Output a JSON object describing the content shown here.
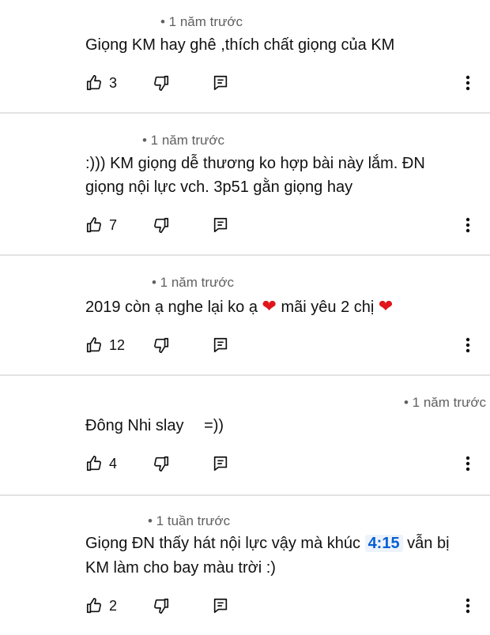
{
  "comments": [
    {
      "time": "• 1 năm trước",
      "lines": [
        "Giọng KM hay ghê ,thích chất giọng của KM"
      ],
      "likes": "3"
    },
    {
      "time": "• 1 năm trước",
      "lines": [
        ":))) KM giọng dễ thương ko hợp bài này lắm. ĐN",
        "giọng nội lực vch. 3p51 gằn giọng hay"
      ],
      "likes": "7"
    },
    {
      "time": "• 1 năm trước",
      "line_part1": "2019 còn ạ nghe lại ko ạ",
      "line_part2": "mãi yêu 2 chị",
      "heart": "❤",
      "likes": "12"
    },
    {
      "time": "• 1 năm trước",
      "line_part1": "Đông Nhi slay",
      "line_part2": "=))",
      "likes": "4"
    },
    {
      "time": "• 1 tuần trước",
      "line1_part1": "Giọng ĐN thấy hát nội lực vậy mà khúc",
      "timestamp": "4:15",
      "line1_part2": "vẫn bị",
      "line2": "KM làm cho bay màu trời :)",
      "likes": "2"
    }
  ],
  "icons": {
    "like": "thumb-up-icon",
    "dislike": "thumb-down-icon",
    "reply": "reply-icon",
    "more": "more-vert-icon"
  },
  "colors": {
    "meta": "#606060",
    "divider": "#e3e3e3",
    "link": "#065fd4",
    "heart": "#e0161c"
  }
}
